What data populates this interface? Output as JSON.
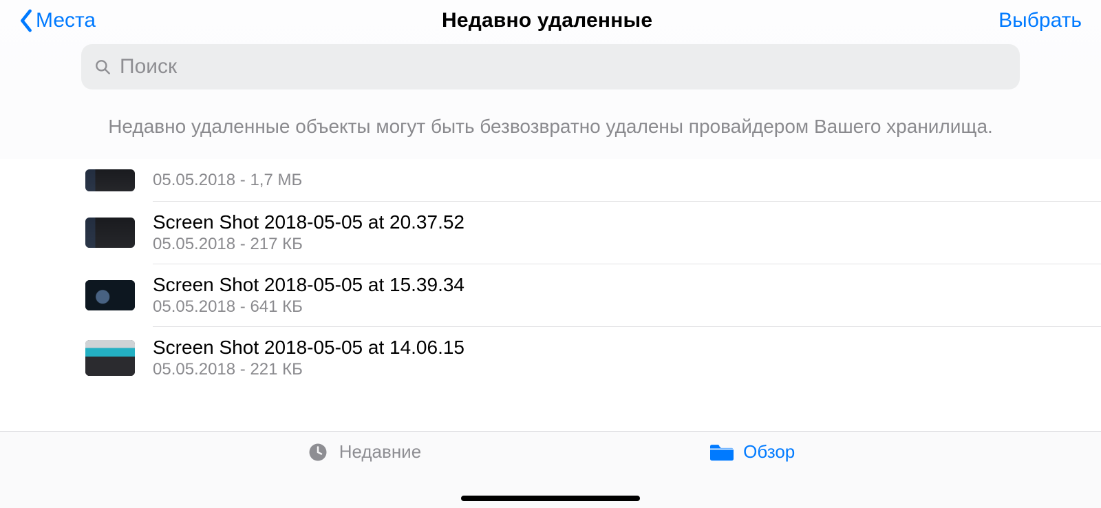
{
  "nav": {
    "back_label": "Места",
    "title": "Недавно удаленные",
    "select_label": "Выбрать"
  },
  "search": {
    "placeholder": "Поиск"
  },
  "banner": {
    "text": "Недавно удаленные объекты могут быть безвозвратно удалены провайдером Вашего хранилища."
  },
  "files": [
    {
      "name": "",
      "meta": "05.05.2018 - 1,7 МБ"
    },
    {
      "name": "Screen Shot 2018-05-05 at 20.37.52",
      "meta": "05.05.2018 - 217 КБ"
    },
    {
      "name": "Screen Shot 2018-05-05 at 15.39.34",
      "meta": "05.05.2018 - 641 КБ"
    },
    {
      "name": "Screen Shot 2018-05-05 at 14.06.15",
      "meta": "05.05.2018 - 221 КБ"
    }
  ],
  "tabs": {
    "recent_label": "Недавние",
    "browse_label": "Обзор"
  }
}
